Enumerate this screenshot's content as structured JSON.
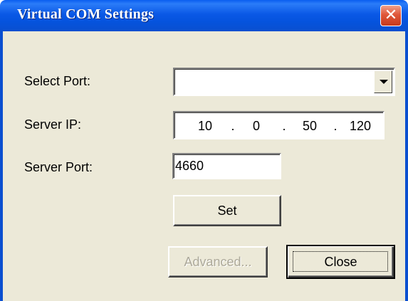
{
  "window": {
    "title": "Virtual COM Settings",
    "close_glyph": "✕",
    "title_bar_color": "#0a58e6",
    "close_button_color": "#e0573a",
    "face_color": "#ece9d8"
  },
  "form": {
    "select_port": {
      "label": "Select Port:",
      "value": "",
      "dropdown_icon": "chevron-down-icon"
    },
    "server_ip": {
      "label": "Server IP:",
      "octets": [
        "10",
        "0",
        "50",
        "120"
      ],
      "separator": "."
    },
    "server_port": {
      "label": "Server Port:",
      "value": "4660"
    }
  },
  "buttons": {
    "set": "Set",
    "advanced": "Advanced...",
    "advanced_enabled": false,
    "close": "Close"
  }
}
